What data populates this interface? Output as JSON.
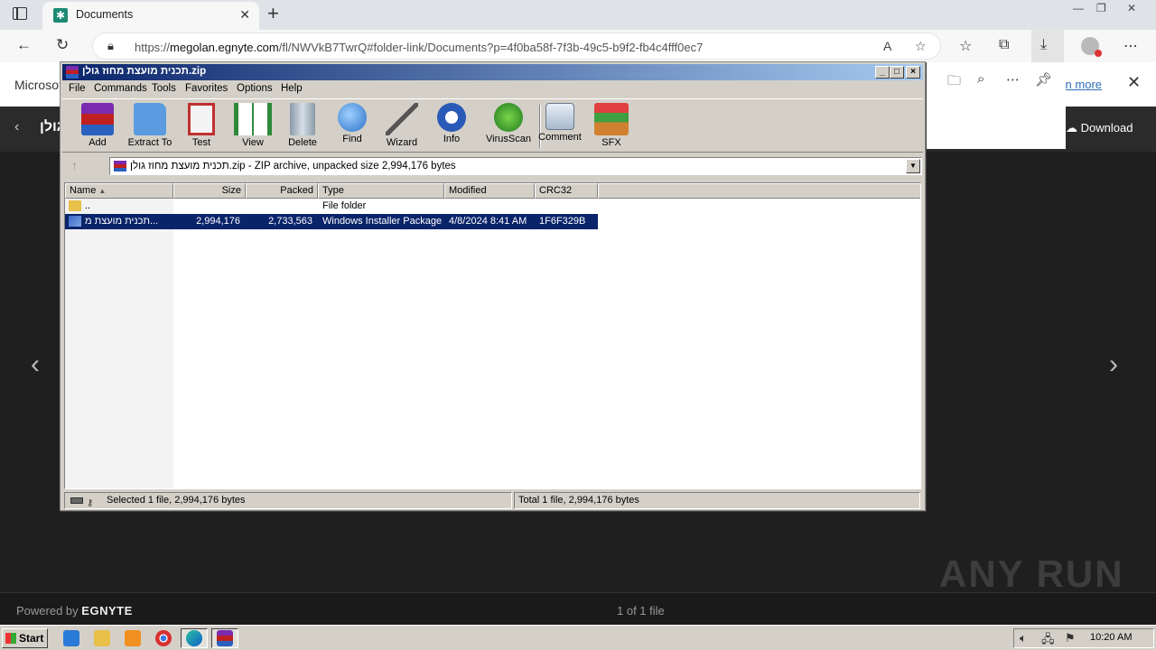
{
  "browser": {
    "tab_title": "Documents",
    "tab_close": "✕",
    "new_tab": "+",
    "url_host": "megolan.egnyte.com",
    "url_prefix": "https://",
    "url_path": "/fl/NWVkB7TwrQ#folder-link/Documents?p=4f0ba58f-7f3b-49c5-b9f2-fb4c4fff0ec7",
    "win_minimize": "—",
    "win_restore": "❐",
    "win_close": "✕"
  },
  "page": {
    "notice_text": "Microsoft",
    "learn_more": "arn more",
    "file_name": "גולן",
    "download_label": "Download",
    "powered_by": "Powered by",
    "brand": "EGNYTE",
    "file_count": "1 of 1 file",
    "watermark": "ANY RUN"
  },
  "winrar": {
    "title": "תכנית מועצת מחוז גולן.zip",
    "menu": [
      "File",
      "Commands",
      "Tools",
      "Favorites",
      "Options",
      "Help"
    ],
    "tools": [
      "Add",
      "Extract To",
      "Test",
      "View",
      "Delete",
      "Find",
      "Wizard",
      "Info",
      "VirusScan",
      "Comment",
      "SFX"
    ],
    "path_text": "תכנית מועצת מחוז גולן.zip - ZIP archive, unpacked size 2,994,176 bytes",
    "columns": [
      "Name",
      "Size",
      "Packed",
      "Type",
      "Modified",
      "CRC32"
    ],
    "rows": [
      {
        "name": "..",
        "size": "",
        "packed": "",
        "type": "File folder",
        "modified": "",
        "crc": ""
      },
      {
        "name": "תכנית מועצת מ...",
        "size": "2,994,176",
        "packed": "2,733,563",
        "type": "Windows Installer Package",
        "modified": "4/8/2024 8:41 AM",
        "crc": "1F6F329B"
      }
    ],
    "status_left": "Selected 1 file, 2,994,176 bytes",
    "status_right": "Total 1 file, 2,994,176 bytes"
  },
  "taskbar": {
    "start": "Start",
    "clock": "10:20 AM"
  }
}
